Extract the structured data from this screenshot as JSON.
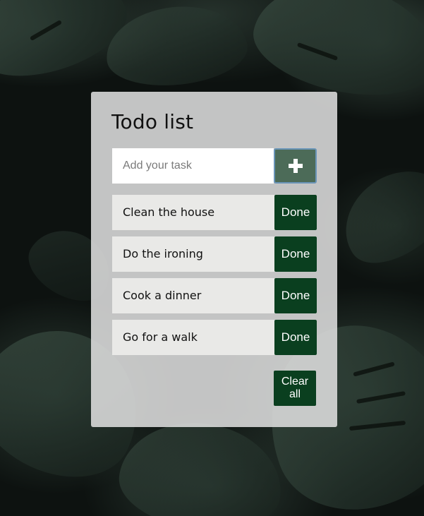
{
  "app": {
    "title": "Todo list"
  },
  "input": {
    "placeholder": "Add your task",
    "value": "",
    "add_icon": "plus-icon"
  },
  "tasks": [
    {
      "label": "Clean the house",
      "action": "Done"
    },
    {
      "label": "Do the ironing",
      "action": "Done"
    },
    {
      "label": "Cook a dinner",
      "action": "Done"
    },
    {
      "label": "Go for a walk",
      "action": "Done"
    }
  ],
  "footer": {
    "clear_label": "Clear all"
  },
  "colors": {
    "accent_dark_green": "#0a3f1f",
    "add_button_green": "#4c6b58",
    "card_background": "#e2e2e2",
    "task_background": "#e9e9e7"
  }
}
